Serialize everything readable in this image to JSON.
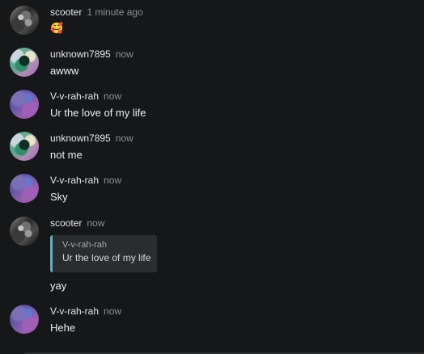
{
  "messages": [
    {
      "author": "scooter",
      "time": "1 minute ago",
      "text": "🥰",
      "avatar": "scooter-avatar"
    },
    {
      "author": "unknown7895",
      "time": "now",
      "text": "awww",
      "avatar": "unknown-avatar"
    },
    {
      "author": "V-v-rah-rah",
      "time": "now",
      "text": "Ur the love of my life",
      "avatar": "vvrah-avatar"
    },
    {
      "author": "unknown7895",
      "time": "now",
      "text": "not me",
      "avatar": "unknown-avatar"
    },
    {
      "author": "V-v-rah-rah",
      "time": "now",
      "text": "Sky",
      "avatar": "vvrah-avatar"
    },
    {
      "author": "scooter",
      "time": "now",
      "text": "yay",
      "avatar": "scooter-avatar",
      "quote": {
        "author": "V-v-rah-rah",
        "text": "Ur the love of my life"
      }
    },
    {
      "author": "V-v-rah-rah",
      "time": "now",
      "text": "Hehe",
      "avatar": "vvrah-avatar"
    }
  ],
  "colors": {
    "background": "#161719",
    "quote_accent": "#5fb0c4",
    "timestamp": "#8d8f93"
  }
}
